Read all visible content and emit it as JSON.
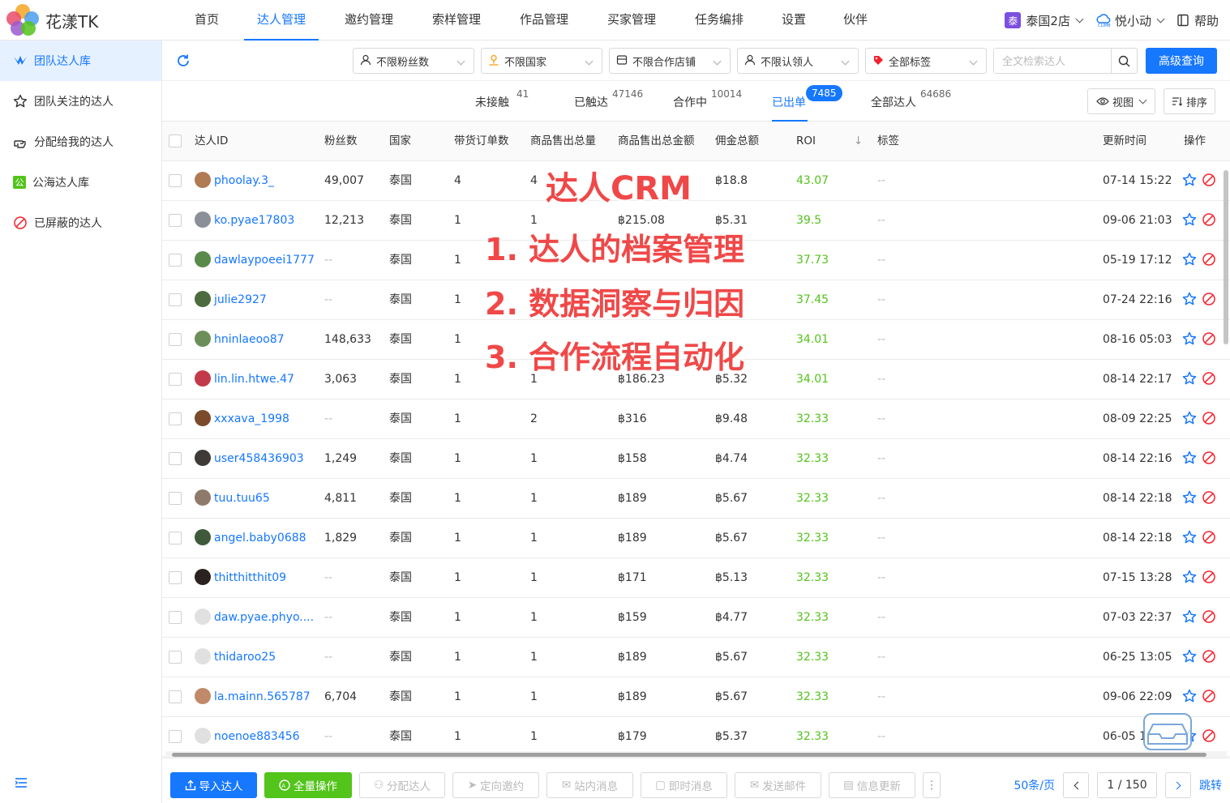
{
  "app": {
    "name": "花漾TK"
  },
  "nav": {
    "items": [
      "首页",
      "达人管理",
      "邀约管理",
      "索样管理",
      "作品管理",
      "买家管理",
      "任务编排",
      "设置",
      "伙伴"
    ],
    "active_index": 1
  },
  "topright": {
    "shop_badge": "泰",
    "shop": "泰国2店",
    "user": "悦小动",
    "help": "帮助"
  },
  "sidebar": {
    "items": [
      {
        "label": "团队达人库",
        "icon": "team-icon"
      },
      {
        "label": "团队关注的达人",
        "icon": "star-icon"
      },
      {
        "label": "分配给我的达人",
        "icon": "hand-point-icon"
      },
      {
        "label": "公海达人库",
        "icon": "public-icon",
        "badge": "公"
      },
      {
        "label": "已屏蔽的达人",
        "icon": "blocked-icon"
      }
    ],
    "active_index": 0
  },
  "filters": {
    "items": [
      "不限粉丝数",
      "不限国家",
      "不限合作店铺",
      "不限认领人",
      "全部标签"
    ],
    "search_placeholder": "全文检索达人",
    "advanced": "高级查询"
  },
  "tabs": {
    "items": [
      {
        "label": "未接触",
        "count": "41"
      },
      {
        "label": "已触达",
        "count": "47146"
      },
      {
        "label": "合作中",
        "count": "10014"
      },
      {
        "label": "已出单",
        "count": "7485"
      },
      {
        "label": "全部达人",
        "count": "64686"
      }
    ],
    "active_index": 3,
    "view": "视图",
    "sort": "排序"
  },
  "table": {
    "columns": [
      "达人ID",
      "粉丝数",
      "国家",
      "带货订单数",
      "商品售出总量",
      "商品售出总金额",
      "佣金总额",
      "ROI",
      "标签",
      "更新时间",
      "操作"
    ],
    "rows": [
      {
        "id": "phoolay.3_",
        "fans": "49,007",
        "country": "泰国",
        "orders": "4",
        "qty": "4",
        "amount": "",
        "commission": "฿18.8",
        "roi": "43.07",
        "tag": "--",
        "updated": "07-14 15:22",
        "avatar": "#b07a52"
      },
      {
        "id": "ko.pyae17803",
        "fans": "12,213",
        "country": "泰国",
        "orders": "1",
        "qty": "1",
        "amount": "฿215.08",
        "commission": "฿5.31",
        "roi": "39.5",
        "tag": "--",
        "updated": "09-06 21:03",
        "avatar": "#8a8f98"
      },
      {
        "id": "dawlaypoeei1777",
        "fans": "--",
        "country": "泰国",
        "orders": "1",
        "qty": "",
        "amount": "",
        "commission": "",
        "roi": "37.73",
        "tag": "--",
        "updated": "05-19 17:12",
        "avatar": "#5a8a4a"
      },
      {
        "id": "julie2927",
        "fans": "--",
        "country": "泰国",
        "orders": "1",
        "qty": "",
        "amount": "",
        "commission": "",
        "roi": "37.45",
        "tag": "--",
        "updated": "07-24 22:16",
        "avatar": "#4c6b3e"
      },
      {
        "id": "hninlaeoo87",
        "fans": "148,633",
        "country": "泰国",
        "orders": "1",
        "qty": "",
        "amount": "",
        "commission": "",
        "roi": "34.01",
        "tag": "--",
        "updated": "08-16 05:03",
        "avatar": "#6c8f5a"
      },
      {
        "id": "lin.lin.htwe.47",
        "fans": "3,063",
        "country": "泰国",
        "orders": "1",
        "qty": "1",
        "amount": "฿186.23",
        "commission": "฿5.32",
        "roi": "34.01",
        "tag": "--",
        "updated": "08-14 22:17",
        "avatar": "#c23a4a"
      },
      {
        "id": "xxxava_1998",
        "fans": "--",
        "country": "泰国",
        "orders": "1",
        "qty": "2",
        "amount": "฿316",
        "commission": "฿9.48",
        "roi": "32.33",
        "tag": "--",
        "updated": "08-09 22:25",
        "avatar": "#7a4a2a"
      },
      {
        "id": "user458436903",
        "fans": "1,249",
        "country": "泰国",
        "orders": "1",
        "qty": "1",
        "amount": "฿158",
        "commission": "฿4.74",
        "roi": "32.33",
        "tag": "--",
        "updated": "08-14 22:16",
        "avatar": "#3d3a38"
      },
      {
        "id": "tuu.tuu65",
        "fans": "4,811",
        "country": "泰国",
        "orders": "1",
        "qty": "1",
        "amount": "฿189",
        "commission": "฿5.67",
        "roi": "32.33",
        "tag": "--",
        "updated": "08-14 22:18",
        "avatar": "#8e7a6a"
      },
      {
        "id": "angel.baby0688",
        "fans": "1,829",
        "country": "泰国",
        "orders": "1",
        "qty": "1",
        "amount": "฿189",
        "commission": "฿5.67",
        "roi": "32.33",
        "tag": "--",
        "updated": "08-14 22:18",
        "avatar": "#3e5a3a"
      },
      {
        "id": "thitthitthit09",
        "fans": "--",
        "country": "泰国",
        "orders": "1",
        "qty": "1",
        "amount": "฿171",
        "commission": "฿5.13",
        "roi": "32.33",
        "tag": "--",
        "updated": "07-15 13:28",
        "avatar": "#2a2220"
      },
      {
        "id": "daw.pyae.phyo....",
        "fans": "--",
        "country": "泰国",
        "orders": "1",
        "qty": "1",
        "amount": "฿159",
        "commission": "฿4.77",
        "roi": "32.33",
        "tag": "--",
        "updated": "07-03 22:37",
        "avatar": "#e0e0e0"
      },
      {
        "id": "thidaroo25",
        "fans": "--",
        "country": "泰国",
        "orders": "1",
        "qty": "1",
        "amount": "฿189",
        "commission": "฿5.67",
        "roi": "32.33",
        "tag": "--",
        "updated": "06-25 13:05",
        "avatar": "#e0e0e0"
      },
      {
        "id": "la.mainn.565787",
        "fans": "6,704",
        "country": "泰国",
        "orders": "1",
        "qty": "1",
        "amount": "฿189",
        "commission": "฿5.67",
        "roi": "32.33",
        "tag": "--",
        "updated": "09-06 22:09",
        "avatar": "#c08a6a"
      },
      {
        "id": "noenoe883456",
        "fans": "--",
        "country": "泰国",
        "orders": "1",
        "qty": "1",
        "amount": "฿179",
        "commission": "฿5.37",
        "roi": "32.33",
        "tag": "--",
        "updated": "06-05 1",
        "avatar": "#e0e0e0"
      }
    ]
  },
  "footer": {
    "buttons": [
      "导入达人",
      "全量操作",
      "分配达人",
      "定向邀约",
      "站内消息",
      "即时消息",
      "发送邮件",
      "信息更新"
    ],
    "page_size": "50条/页",
    "page": "1 / 150",
    "jump": "跳转"
  },
  "overlay": {
    "title": "达人CRM",
    "lines": [
      "1. 达人的档案管理",
      "2. 数据洞察与归因",
      "3. 合作流程自动化"
    ]
  },
  "colors": {
    "primary": "#1677ff",
    "green": "#52c41a",
    "overlay_red": "#f04848"
  }
}
